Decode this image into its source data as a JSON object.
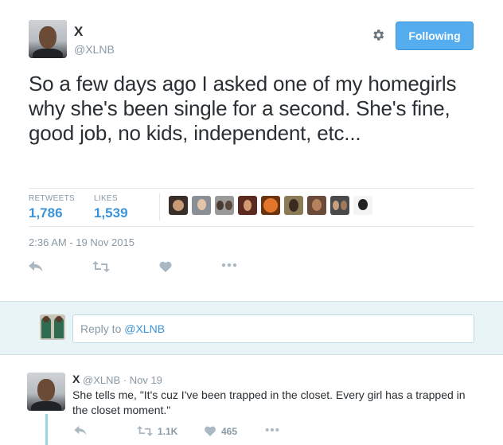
{
  "tweet": {
    "name": "X",
    "handle": "@XLNB",
    "follow_label": "Following",
    "text": "So a few days ago I asked one of my homegirls why she's been single for a second. She's fine, good job, no kids, independent, etc...",
    "stats": {
      "retweets_label": "RETWEETS",
      "retweets_value": "1,786",
      "likes_label": "LIKES",
      "likes_value": "1,539"
    },
    "timestamp": "2:36 AM - 19 Nov 2015",
    "likers_count": 9
  },
  "reply_box": {
    "prefix": "Reply to ",
    "handle": "@XLNB"
  },
  "reply_tweet": {
    "name": "X",
    "meta": "@XLNB · Nov 19",
    "text": "She tells me, \"It's cuz I've been trapped in the closet. Every girl has a trapped in the closet moment.\"",
    "retweet_count": "1.1K",
    "like_count": "465"
  },
  "icons": {
    "settings": "gear-icon",
    "reply": "reply-icon",
    "retweet": "retweet-icon",
    "like": "heart-icon",
    "more": "more-icon"
  },
  "colors": {
    "accent": "#55acee",
    "link": "#3b94d9",
    "muted": "#8899a6",
    "reply_bg": "#e8f4f6"
  }
}
